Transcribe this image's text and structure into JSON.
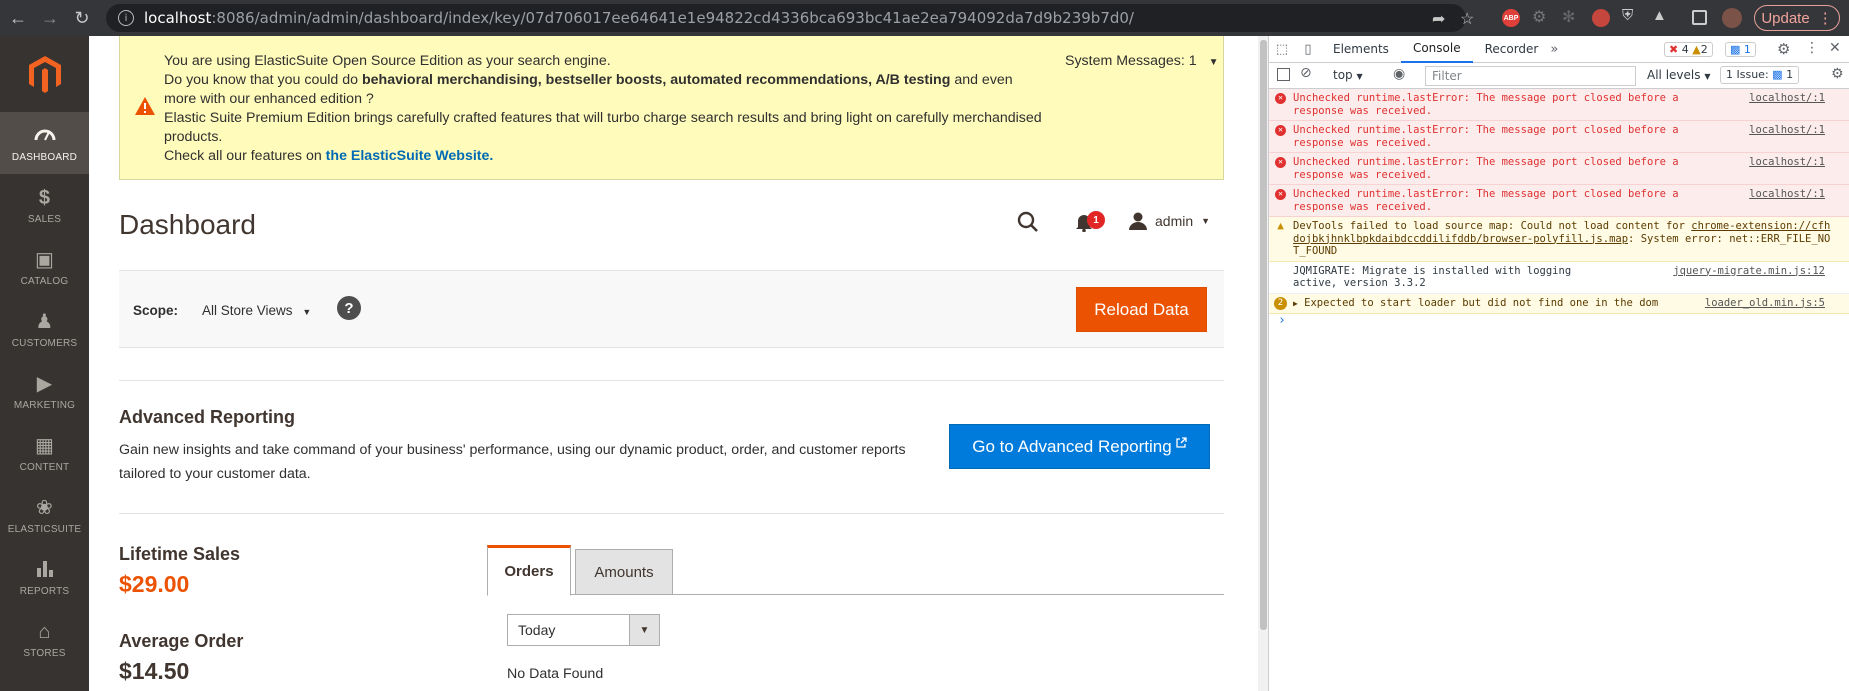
{
  "browser": {
    "url_host": "localhost",
    "url_path": ":8086/admin/admin/dashboard/index/key/07d706017ee64641e1e94822cd4336bca693bc41ae2ea794092da7d9b239b7d0/",
    "update_label": "Update"
  },
  "sidebar": {
    "items": [
      {
        "label": "DASHBOARD",
        "icon": "dashboard-icon"
      },
      {
        "label": "SALES",
        "icon": "dollar-icon"
      },
      {
        "label": "CATALOG",
        "icon": "box-icon"
      },
      {
        "label": "CUSTOMERS",
        "icon": "person-icon"
      },
      {
        "label": "MARKETING",
        "icon": "megaphone-icon"
      },
      {
        "label": "CONTENT",
        "icon": "layout-icon"
      },
      {
        "label": "ELASTICSUITE",
        "icon": "elasticsuite-icon"
      },
      {
        "label": "REPORTS",
        "icon": "bar-chart-icon"
      },
      {
        "label": "STORES",
        "icon": "store-icon"
      }
    ]
  },
  "sysmsg": {
    "line1": "You are using ElasticSuite Open Source Edition as your search engine.",
    "line2_pre": "Do you know that you could do ",
    "line2_bold": "behavioral merchandising, bestseller boosts, automated recommendations, A/B testing",
    "line2_post": " and even more with our enhanced edition ?",
    "line3": "Elastic Suite Premium Edition brings carefully crafted features that will turbo charge search results and bring light on carefully merchandised products.",
    "line4_pre": "Check all our features on ",
    "line4_link": "the ElasticSuite Website.",
    "count_label": "System Messages: 1"
  },
  "header": {
    "title": "Dashboard",
    "notification_count": "1",
    "user": "admin"
  },
  "scope": {
    "label": "Scope:",
    "value": "All Store Views",
    "help": "?",
    "reload_label": "Reload Data"
  },
  "advanced": {
    "title": "Advanced Reporting",
    "description": "Gain new insights and take command of your business' performance, using our dynamic product, order, and customer reports tailored to your customer data.",
    "button_label": "Go to Advanced Reporting"
  },
  "stats": {
    "lifetime_label": "Lifetime Sales",
    "lifetime_value": "$29.00",
    "avg_label": "Average Order",
    "avg_value": "$14.50"
  },
  "tabs": [
    {
      "label": "Orders",
      "active": true
    },
    {
      "label": "Amounts",
      "active": false
    }
  ],
  "period": {
    "value": "Today"
  },
  "no_data": "No Data Found",
  "devtools": {
    "tabs": [
      "Elements",
      "Console",
      "Recorder"
    ],
    "error_badge": "4",
    "warn_badge": "2",
    "msg_badge": "1",
    "context": "top",
    "filter_placeholder": "Filter",
    "levels": "All levels",
    "issues": "1 Issue:",
    "issues_count": "1",
    "logs": [
      {
        "type": "error",
        "text": "Unchecked runtime.lastError: The message port closed before a response was received.",
        "src": "localhost/:1"
      },
      {
        "type": "error",
        "text": "Unchecked runtime.lastError: The message port closed before a response was received.",
        "src": "localhost/:1"
      },
      {
        "type": "error",
        "text": "Unchecked runtime.lastError: The message port closed before a response was received.",
        "src": "localhost/:1"
      },
      {
        "type": "error",
        "text": "Unchecked runtime.lastError: The message port closed before a response was received.",
        "src": "localhost/:1"
      },
      {
        "type": "warn",
        "text_pre": "DevTools failed to load source map: Could not load content for ",
        "link": "chrome-extension://cfhdojbkjhnklbpkdaibdccddilifddb/browser-polyfill.js.map",
        "text_post": ": System error: net::ERR_FILE_NOT_FOUND"
      },
      {
        "type": "info",
        "text": "JQMIGRATE: Migrate is installed with logging active, version 3.3.2",
        "src": "jquery-migrate.min.js:12"
      },
      {
        "type": "warn-count",
        "count": "2",
        "text": "Expected to start loader but did not find one in the dom",
        "src": "loader_old.min.js:5"
      }
    ],
    "prompt": "›"
  }
}
